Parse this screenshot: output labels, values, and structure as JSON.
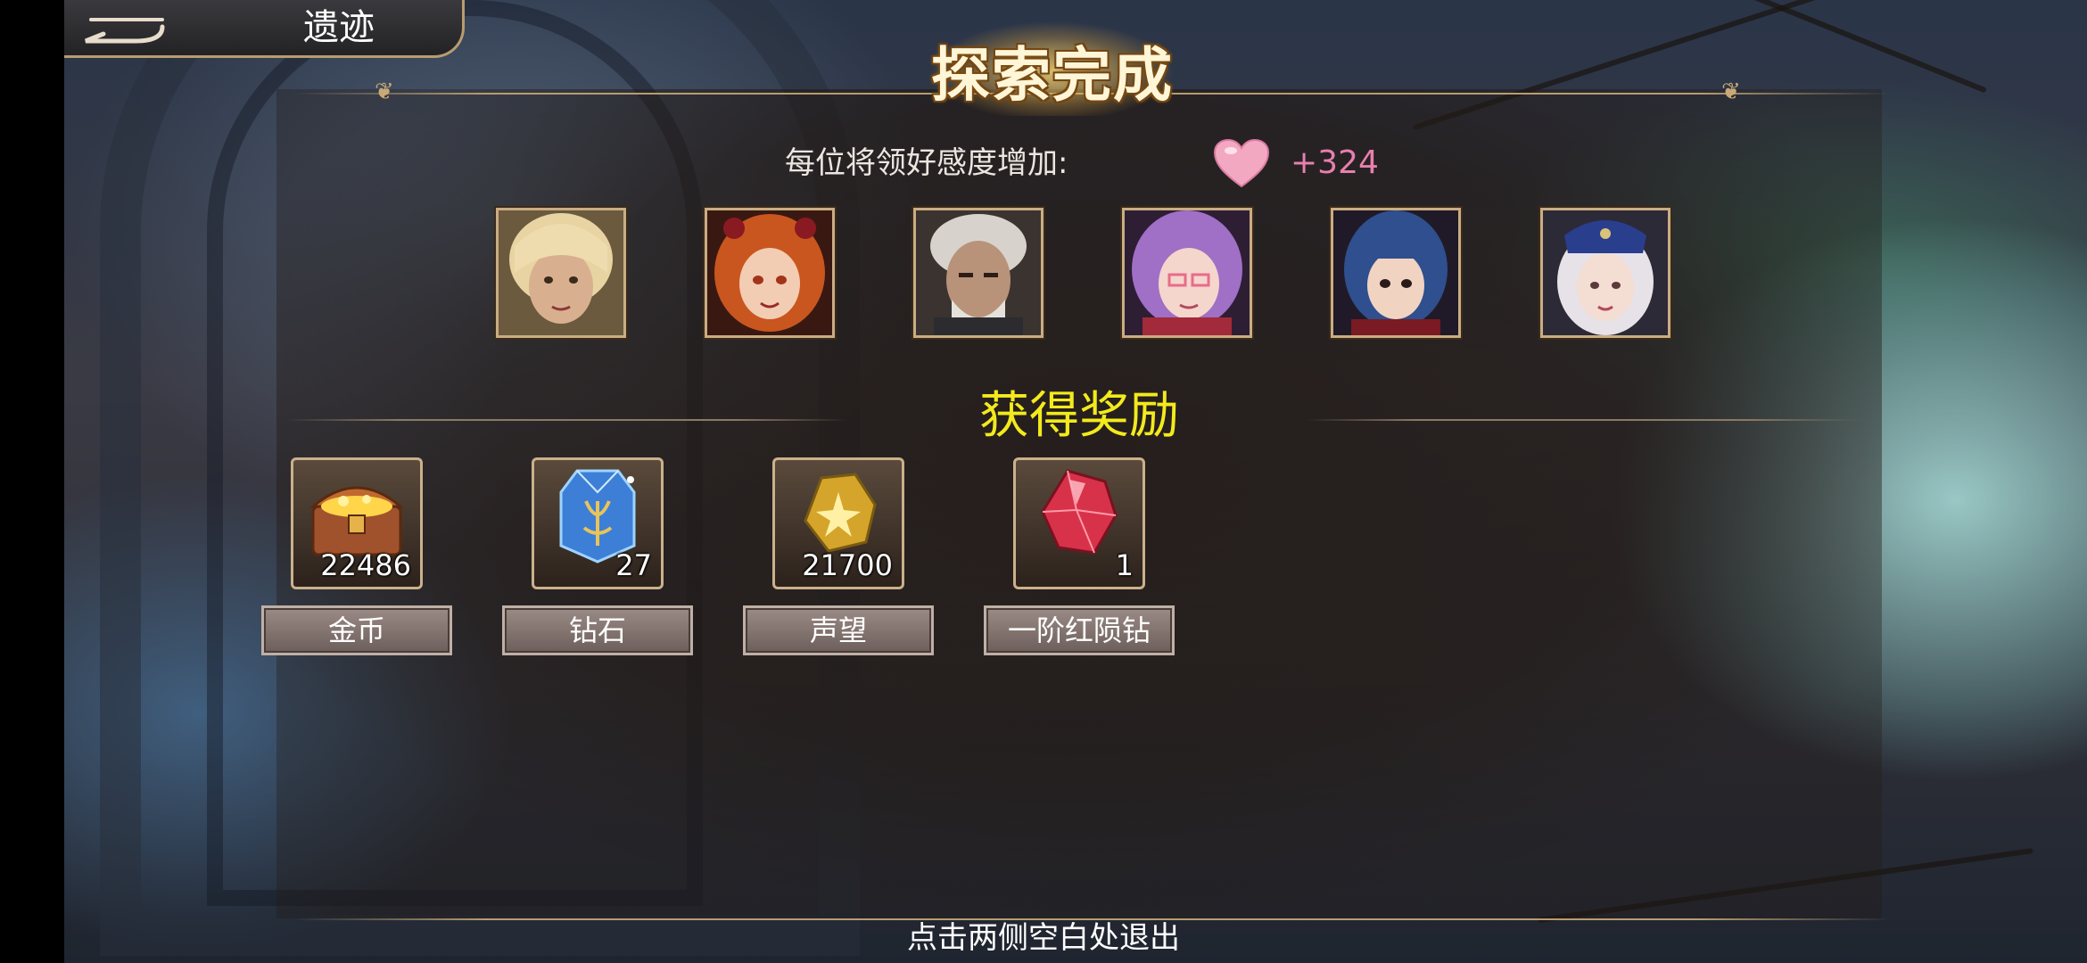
{
  "header": {
    "title": "遗迹",
    "back_icon": "back-arrow-icon"
  },
  "banner": {
    "title": "探索完成"
  },
  "affinity": {
    "label": "每位将领好感度增加:",
    "icon": "heart-icon",
    "value": "+324",
    "value_color": "#e87fae"
  },
  "portraits": [
    {
      "name": "blonde-woman-portrait"
    },
    {
      "name": "orange-hair-girl-portrait"
    },
    {
      "name": "white-hair-old-man-portrait"
    },
    {
      "name": "purple-hair-glasses-girl-portrait"
    },
    {
      "name": "blue-hair-girl-portrait"
    },
    {
      "name": "white-hair-captain-girl-portrait"
    }
  ],
  "rewards": {
    "title": "获得奖励",
    "title_color": "#f2ea1c",
    "items": [
      {
        "icon": "treasure-chest-icon",
        "qty": "22486",
        "name": "金币"
      },
      {
        "icon": "blue-crystal-icon",
        "qty": "27",
        "name": "钻石"
      },
      {
        "icon": "gold-emblem-icon",
        "qty": "21700",
        "name": "声望"
      },
      {
        "icon": "red-gem-icon",
        "qty": "1",
        "name": "一阶红陨钻"
      }
    ]
  },
  "footer": {
    "exit_hint": "点击两侧空白处退出"
  }
}
